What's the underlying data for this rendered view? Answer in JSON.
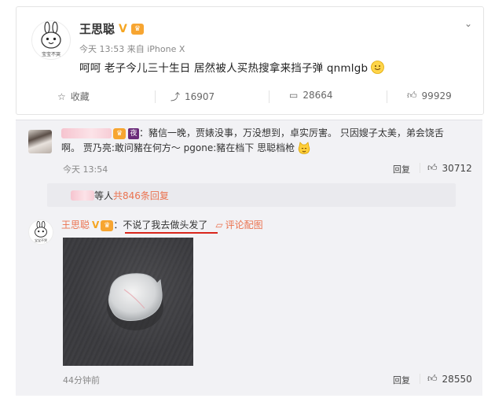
{
  "post": {
    "username": "王思聪",
    "v_badge": "V",
    "time": "今天 13:53",
    "source_prefix": "来自",
    "source": "iPhone X",
    "text": "呵呵 老子今儿三十生日 居然被人买热搜拿来挡子弹 qnmlgb",
    "avatar_caption": "宝宝不哭",
    "actions": {
      "favorite_label": "收藏",
      "repost_count": "16907",
      "comment_count": "28664",
      "like_count": "99929"
    }
  },
  "comments": [
    {
      "badge": "夜",
      "text_line1": "：豬信一晚，贾婊没事，万没想到，卓实厉害。 只因嫂子太美，弟会饶舌",
      "text_line2_a": "啊。 贾乃亮:敢问豬在何方～ pgone:豬在档下 思聪档枪",
      "time": "今天 13:54",
      "reply_label": "回复",
      "like_count": "30712",
      "replies_summary": {
        "suffix_a": "等人 ",
        "count_text": "共846条回复"
      }
    },
    {
      "username": "王思聪",
      "v_badge": "V",
      "text": "不说了我去做头发了",
      "colon": "：",
      "pic_link": "评论配图",
      "avatar_caption": "宝宝不哭",
      "time": "44分钟前",
      "reply_label": "回复",
      "like_count": "28550"
    }
  ],
  "colors": {
    "accent_orange": "#eb7350",
    "v_gold": "#f5a623",
    "underline_red": "#d9261c"
  }
}
